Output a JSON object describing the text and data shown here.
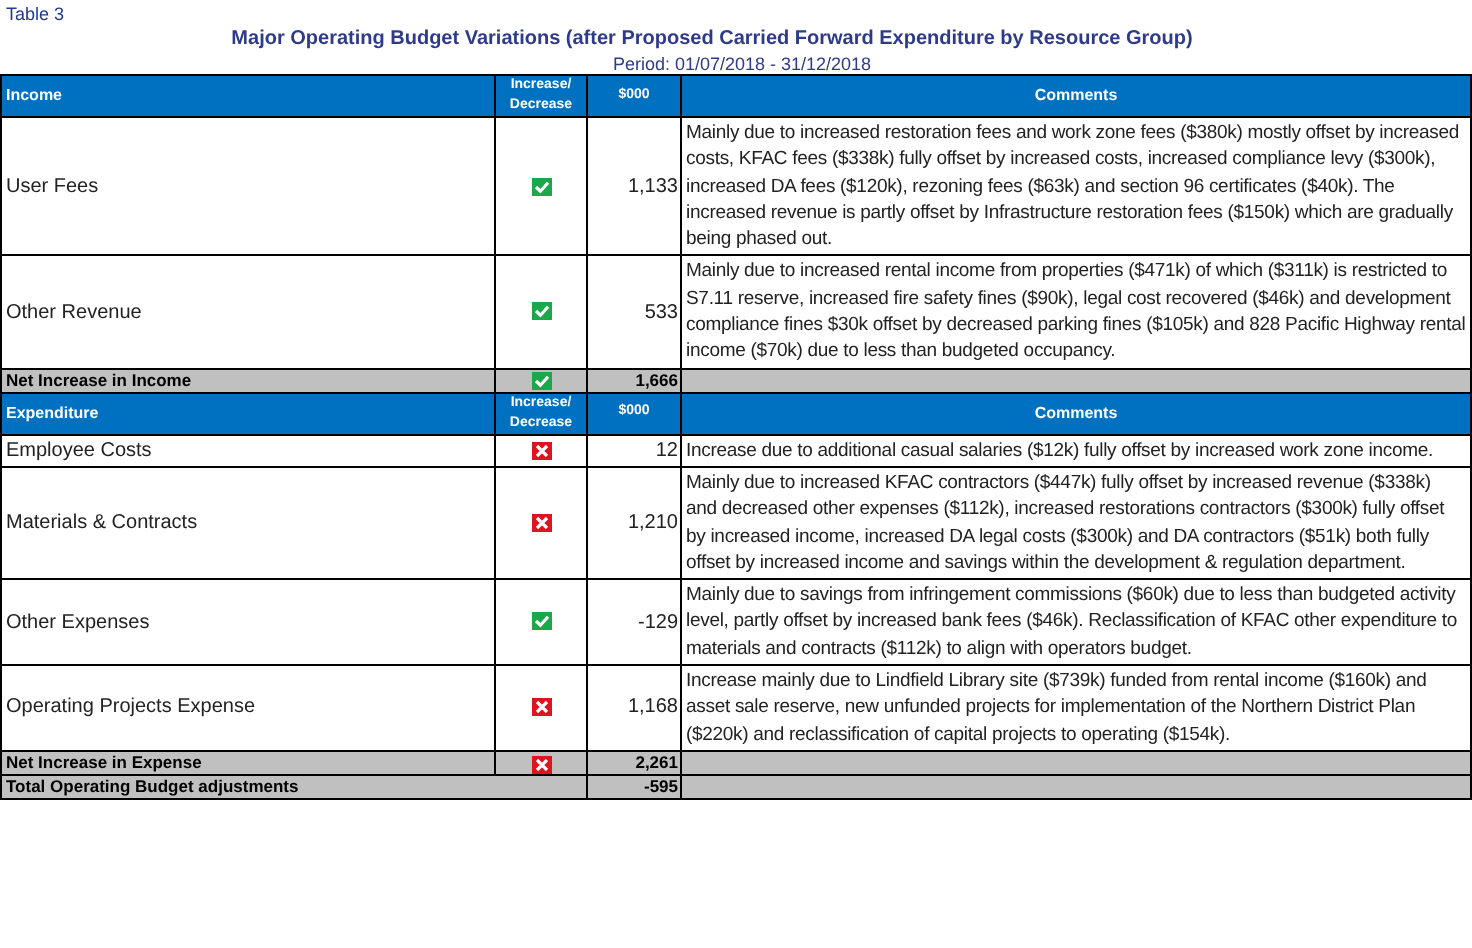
{
  "caption": "Table 3",
  "title": "Major Operating Budget Variations (after Proposed Carried Forward Expenditure by Resource Group)",
  "period": "Period: 01/07/2018 - 31/12/2018",
  "sections": [
    {
      "header": {
        "label": "Income",
        "column_2": "Increase/ Decrease",
        "column_3": "$000",
        "column_4": "Comments"
      },
      "rows": [
        {
          "label": "User Fees",
          "favourable": true,
          "value": "1,133",
          "comment": "Mainly due to increased restoration fees and work zone fees ($380k) mostly offset by increased costs, KFAC fees ($338k) fully offset by increased costs, increased compliance levy ($300k),  increased DA fees ($120k), rezoning fees ($63k) and section 96 certificates ($40k). The increased revenue is partly offset by Infrastructure restoration fees ($150k) which are gradually being phased out."
        },
        {
          "label": "Other Revenue",
          "favourable": true,
          "value": "533",
          "comment": "Mainly due to increased rental income from properties ($471k) of which ($311k) is restricted to S7.11 reserve, increased fire safety fines ($90k), legal cost recovered ($46k) and development compliance fines $30k offset by decreased parking fines ($105k) and 828 Pacific Highway rental income ($70k) due to less than budgeted occupancy."
        }
      ],
      "subtotal": {
        "label": "Net Increase in Income",
        "favourable": true,
        "value": "1,666"
      }
    },
    {
      "header": {
        "label": "Expenditure",
        "column_2": "Increase/ Decrease",
        "column_3": "$000",
        "column_4": "Comments"
      },
      "rows": [
        {
          "label": "Employee Costs",
          "favourable": false,
          "value": "12",
          "comment": "Increase due to additional casual salaries ($12k) fully offset by increased work zone income."
        },
        {
          "label": "Materials & Contracts",
          "favourable": false,
          "value": "1,210",
          "comment": "Mainly due to increased KFAC contractors ($447k) fully offset by increased revenue ($338k) and decreased other expenses ($112k), increased restorations contractors ($300k) fully offset by increased income, increased DA legal costs ($300k) and DA contractors ($51k) both fully offset by increased income and savings within the development & regulation department."
        },
        {
          "label": "Other Expenses",
          "favourable": true,
          "value": "-129",
          "comment": "Mainly due to savings from infringement commissions ($60k) due to less than budgeted activity level, partly offset by increased bank fees ($46k). Reclassification of KFAC other expenditure to materials and contracts ($112k) to align with operators budget."
        },
        {
          "label": "Operating Projects Expense",
          "favourable": false,
          "value": "1,168",
          "comment": "Increase mainly due to Lindfield Library site ($739k) funded from rental income ($160k) and asset sale reserve, new unfunded projects for implementation of the Northern District Plan ($220k) and reclassification of capital projects to operating ($154k)."
        }
      ],
      "subtotal": {
        "label": "Net Increase in Expense",
        "favourable": false,
        "value": "2,261"
      }
    }
  ],
  "total": {
    "label": "Total Operating Budget adjustments",
    "value": "-595"
  }
}
